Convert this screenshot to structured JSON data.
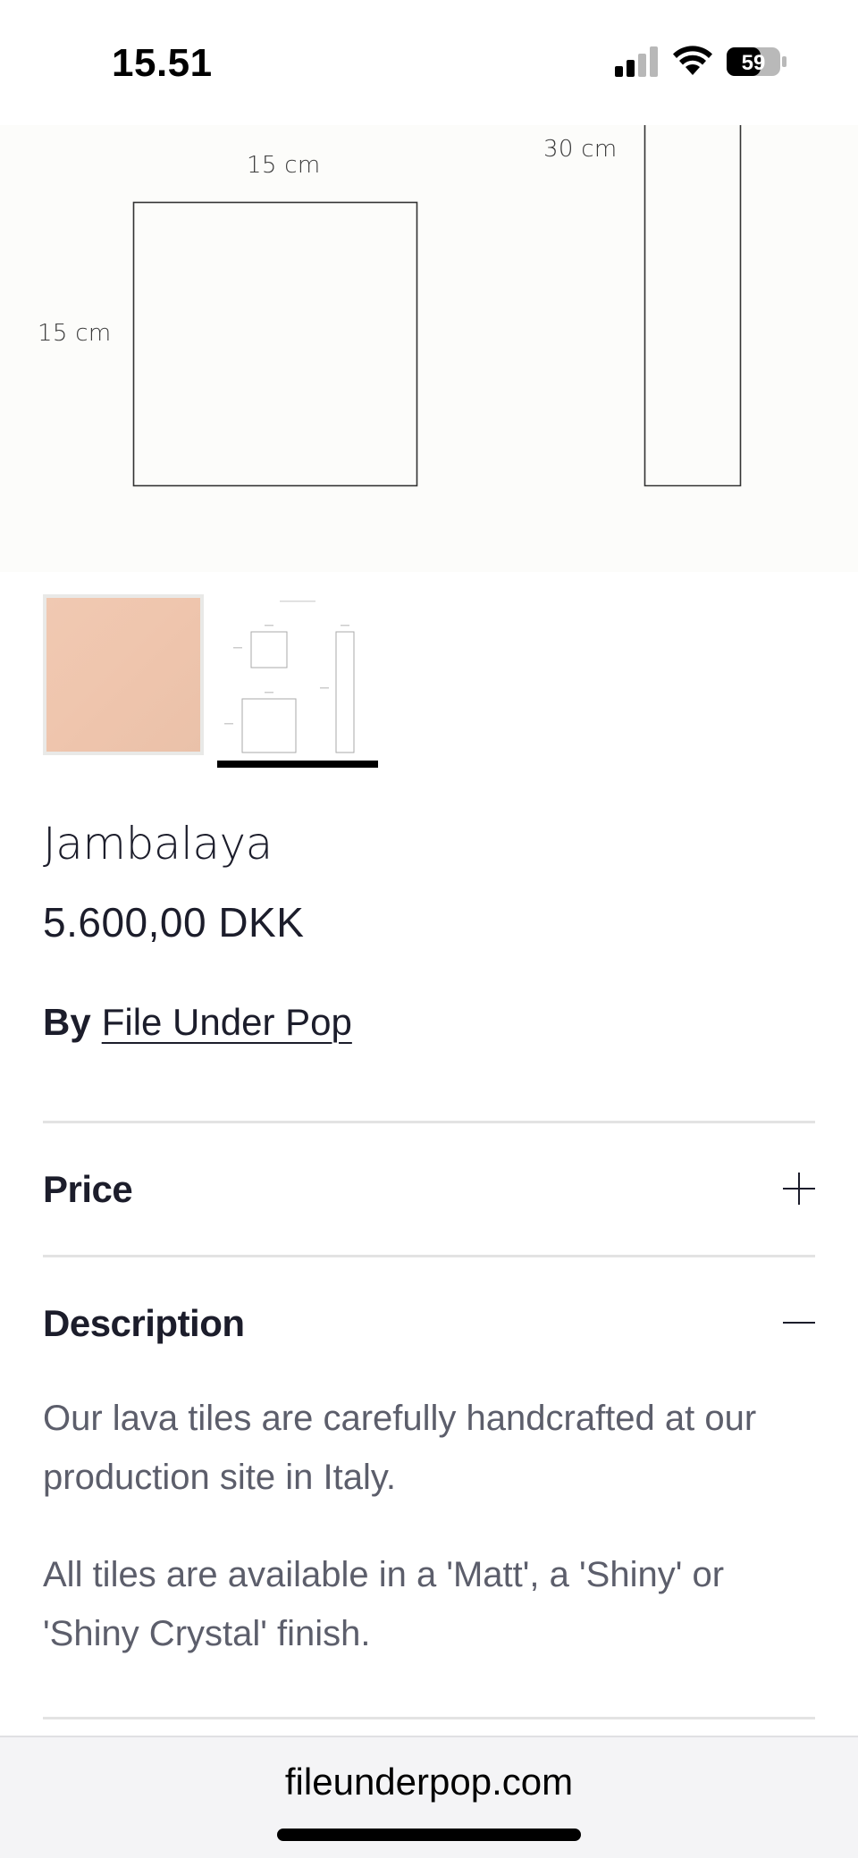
{
  "status_bar": {
    "time": "15.51",
    "battery_level": "59",
    "icons": [
      "cellular-signal-icon",
      "wifi-icon",
      "battery-icon"
    ]
  },
  "hero": {
    "square_width_label": "15 cm",
    "square_height_label": "15 cm",
    "rect_height_label": "30 cm"
  },
  "gallery": {
    "selected_index": 1,
    "thumbnails": [
      "tile-photo",
      "dimension-drawing"
    ]
  },
  "product": {
    "title": "Jambalaya",
    "price": "5.600,00 DKK",
    "by_label": "By",
    "vendor": "File Under Pop"
  },
  "accordion": {
    "price": {
      "title": "Price",
      "expanded": false
    },
    "description": {
      "title": "Description",
      "expanded": true,
      "paragraphs": [
        "Our lava tiles are carefully handcrafted at our production site in Italy.",
        "All tiles are available in a 'Matt', a 'Shiny' or 'Shiny Crystal' finish."
      ]
    }
  },
  "browser": {
    "url": "fileunderpop.com"
  },
  "colors": {
    "text_primary": "#1c1d2b",
    "text_secondary": "#5c5e6b",
    "tile_color": "#efc5ad",
    "divider": "#e3e3e3"
  }
}
